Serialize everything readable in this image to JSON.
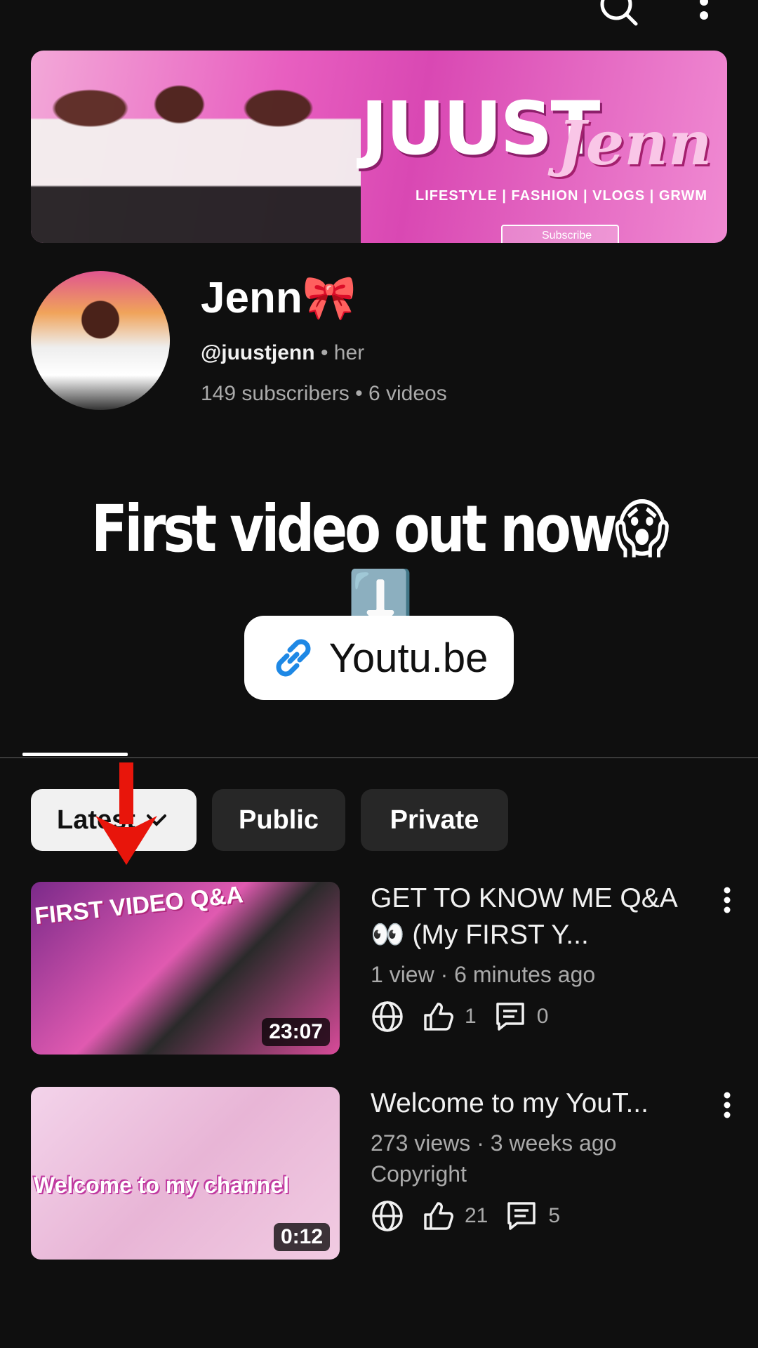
{
  "channel": {
    "banner": {
      "title": "JUUST",
      "script": "Jenn",
      "tags": "LIFESTYLE | FASHION | VLOGS | GRWM",
      "subscribe": "Subscribe"
    },
    "name": "Jenn🎀",
    "handle": "@juustjenn",
    "pronouns": "her",
    "subscribers": "149 subscribers",
    "videos_count": "6 videos"
  },
  "overlay": {
    "headline": "First video out now😱⬇️",
    "link_label": "Youtu.be"
  },
  "filters": {
    "items": [
      {
        "label": "Latest",
        "selected": true
      },
      {
        "label": "Public",
        "selected": false
      },
      {
        "label": "Private",
        "selected": false
      }
    ]
  },
  "videos": [
    {
      "title": "GET TO KNOW ME Q&A👀 (My FIRST Y...",
      "meta": "1 view · 6 minutes ago",
      "extra": "",
      "likes": "1",
      "comments": "0",
      "duration": "23:07",
      "thumb_text": "FIRST VIDEO Q&A"
    },
    {
      "title": "Welcome to my YouT...",
      "meta": "273 views · 3 weeks ago",
      "extra": "Copyright",
      "likes": "21",
      "comments": "5",
      "duration": "0:12",
      "thumb_text": "Welcome to my channel"
    }
  ],
  "colors": {
    "background": "#0f0f0f",
    "chip_selected": "#f1f1f1",
    "chip_dark": "#272727",
    "link_icon": "#1e88e5",
    "annotation_arrow": "#e8150b"
  }
}
